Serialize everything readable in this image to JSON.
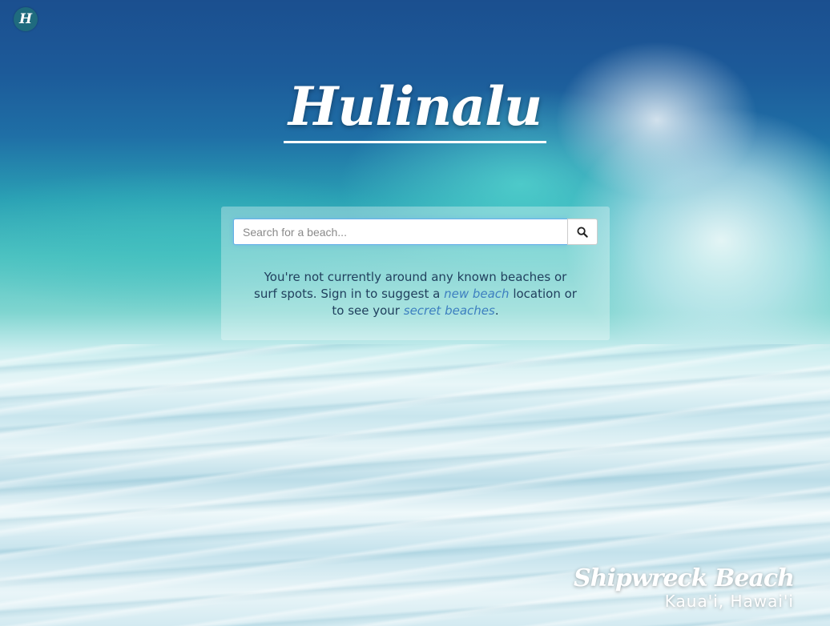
{
  "logo": {
    "letter": "H"
  },
  "brand": {
    "title": "Hulinalu"
  },
  "search": {
    "placeholder": "Search for a beach...",
    "value": "",
    "button_icon": "search-icon"
  },
  "message": {
    "line_intro": "You're not currently around any known beaches or surf spots. Sign in to suggest a ",
    "new_beach_link": "new beach",
    "line_mid": " location or to see your ",
    "secret_beaches_link": "secret beaches",
    "line_end": "."
  },
  "photo_caption": {
    "title": "Shipwreck Beach",
    "location": "Kaua'i, Hawai'i"
  },
  "colors": {
    "link": "#3d7fc0",
    "message_text": "#21405e",
    "input_focus": "#66afe9",
    "logo_badge": "#1f6b7e"
  }
}
